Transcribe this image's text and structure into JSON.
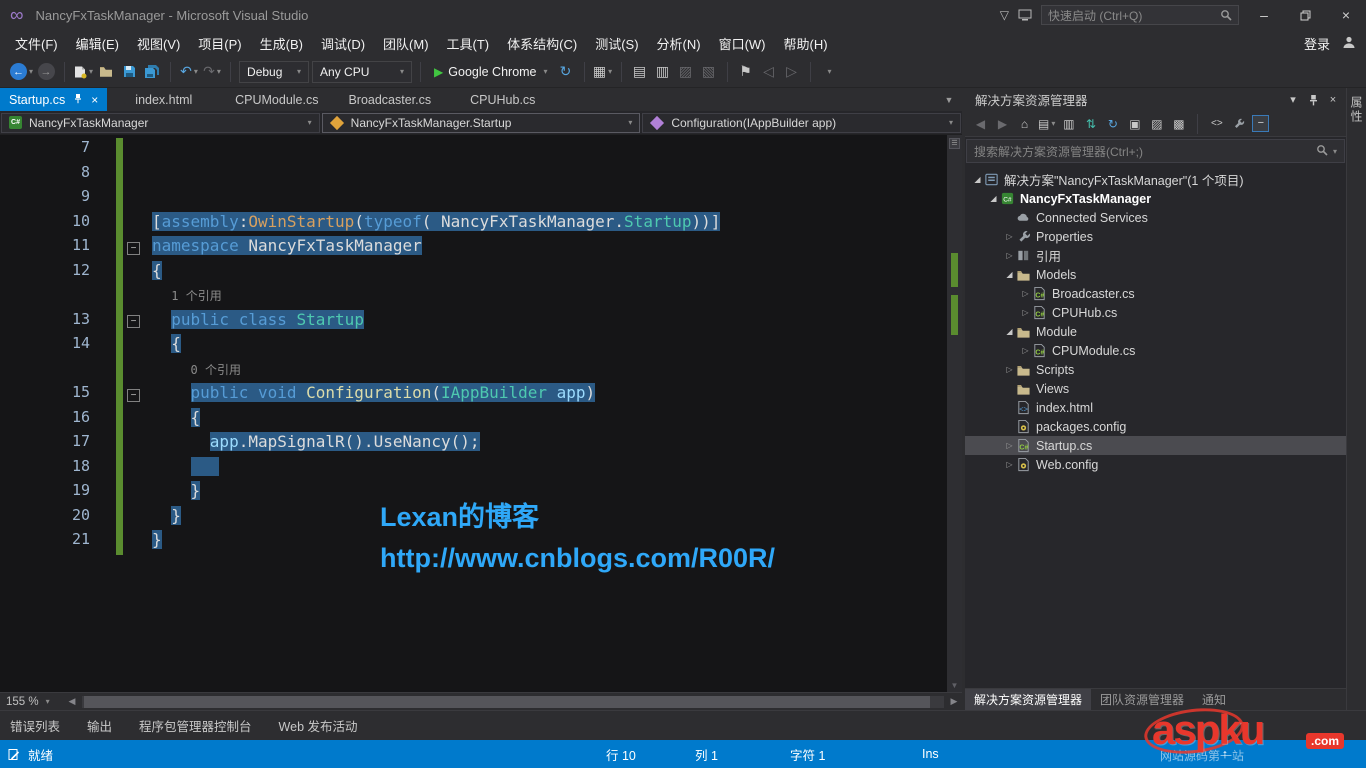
{
  "title_bar": {
    "title": "NancyFxTaskManager - Microsoft Visual Studio",
    "quick_launch_placeholder": "快速启动 (Ctrl+Q)"
  },
  "menu_bar": {
    "items": [
      "文件(F)",
      "编辑(E)",
      "视图(V)",
      "项目(P)",
      "生成(B)",
      "调试(D)",
      "团队(M)",
      "工具(T)",
      "体系结构(C)",
      "测试(S)",
      "分析(N)",
      "窗口(W)",
      "帮助(H)"
    ],
    "sign_in": "登录"
  },
  "toolbar": {
    "debug_config": "Debug",
    "platform": "Any CPU",
    "start_target": "Google Chrome"
  },
  "tab_bar": {
    "tabs": [
      {
        "label": "Startup.cs",
        "active": true,
        "pinned": true
      },
      {
        "label": "index.html",
        "active": false
      },
      {
        "label": "CPUModule.cs",
        "active": false
      },
      {
        "label": "Broadcaster.cs",
        "active": false
      },
      {
        "label": "CPUHub.cs",
        "active": false
      }
    ]
  },
  "nav_bar": {
    "project": "NancyFxTaskManager",
    "type": "NancyFxTaskManager.Startup",
    "member": "Configuration(IAppBuilder app)"
  },
  "editor": {
    "zoom": "155 %",
    "watermark_line1": "Lexan的博客",
    "watermark_line2": "http://www.cnblogs.com/R00R/",
    "code_rows": [
      {
        "n": "7",
        "chg": true,
        "pre": "",
        "seg": []
      },
      {
        "n": "8",
        "chg": true,
        "pre": "",
        "seg": []
      },
      {
        "n": "9",
        "chg": true,
        "pre": "",
        "seg": []
      },
      {
        "n": "10",
        "chg": true,
        "sel": true,
        "pre": "",
        "seg": [
          [
            "[",
            "pl"
          ],
          [
            "assembly",
            "kw"
          ],
          [
            ":",
            "pl"
          ],
          [
            "OwinStartup",
            "at"
          ],
          [
            "(",
            "pl"
          ],
          [
            "typeof",
            "kw"
          ],
          [
            "( ",
            "pl"
          ],
          [
            "NancyFxTaskManager",
            "pl"
          ],
          [
            ".",
            "pl"
          ],
          [
            "Startup",
            "ty"
          ],
          [
            "))]",
            "pl"
          ]
        ]
      },
      {
        "n": "11",
        "chg": true,
        "sel": true,
        "fold": true,
        "pre": "",
        "seg": [
          [
            "namespace",
            "kw"
          ],
          [
            " NancyFxTaskManager",
            "pl"
          ]
        ]
      },
      {
        "n": "12",
        "chg": true,
        "sel": true,
        "pre": "",
        "seg": [
          [
            "{",
            "pl"
          ]
        ]
      },
      {
        "n": "",
        "lens": true,
        "chg": true,
        "pre": "  ",
        "seg": [
          [
            "1 个引用",
            "lens"
          ]
        ]
      },
      {
        "n": "13",
        "chg": true,
        "sel": true,
        "fold": true,
        "pre": "  ",
        "seg": [
          [
            "public",
            "kw"
          ],
          [
            " ",
            "pl"
          ],
          [
            "class",
            "kw"
          ],
          [
            " ",
            "pl"
          ],
          [
            "Startup",
            "ty"
          ]
        ]
      },
      {
        "n": "14",
        "chg": true,
        "sel": true,
        "pre": "  ",
        "seg": [
          [
            "{",
            "pl"
          ]
        ]
      },
      {
        "n": "",
        "lens": true,
        "chg": true,
        "pre": "    ",
        "seg": [
          [
            "0 个引用",
            "lens"
          ]
        ]
      },
      {
        "n": "15",
        "chg": true,
        "sel": true,
        "fold": true,
        "pre": "    ",
        "seg": [
          [
            "public",
            "kw"
          ],
          [
            " ",
            "pl"
          ],
          [
            "void",
            "kw"
          ],
          [
            " ",
            "pl"
          ],
          [
            "Configuration",
            "me"
          ],
          [
            "(",
            "pl"
          ],
          [
            "IAppBuilder",
            "ty"
          ],
          [
            " ",
            "pl"
          ],
          [
            "app",
            "pa"
          ],
          [
            ")",
            "pl"
          ]
        ]
      },
      {
        "n": "16",
        "chg": true,
        "sel": true,
        "pre": "    ",
        "seg": [
          [
            "{",
            "pl"
          ]
        ]
      },
      {
        "n": "17",
        "chg": true,
        "sel": true,
        "pre": "      ",
        "seg": [
          [
            "app",
            "pa"
          ],
          [
            ".MapSignalR().UseNancy();",
            "pl"
          ]
        ]
      },
      {
        "n": "18",
        "chg": true,
        "sel": true,
        "pre": "    ",
        "seg": [
          [
            "   ",
            "pl"
          ]
        ]
      },
      {
        "n": "19",
        "chg": true,
        "sel": true,
        "pre": "    ",
        "seg": [
          [
            "}",
            "pl"
          ]
        ]
      },
      {
        "n": "20",
        "chg": true,
        "sel": true,
        "pre": "  ",
        "seg": [
          [
            "}",
            "pl"
          ]
        ]
      },
      {
        "n": "21",
        "chg": true,
        "sel": true,
        "pre": "",
        "seg": [
          [
            "}",
            "pl"
          ]
        ]
      }
    ]
  },
  "solution_explorer": {
    "title": "解决方案资源管理器",
    "search_placeholder": "搜索解决方案资源管理器(Ctrl+;)",
    "tree": [
      {
        "indent": 0,
        "arrow": "open",
        "icon": "solution",
        "label": "解决方案\"NancyFxTaskManager\"(1 个项目)"
      },
      {
        "indent": 1,
        "arrow": "open",
        "icon": "project",
        "label": "NancyFxTaskManager",
        "bold": true
      },
      {
        "indent": 2,
        "arrow": "none",
        "icon": "cloud",
        "label": "Connected Services"
      },
      {
        "indent": 2,
        "arrow": "closed",
        "icon": "wrench",
        "label": "Properties"
      },
      {
        "indent": 2,
        "arrow": "closed",
        "icon": "refs",
        "label": "引用"
      },
      {
        "indent": 2,
        "arrow": "open",
        "icon": "folder",
        "label": "Models"
      },
      {
        "indent": 3,
        "arrow": "closed",
        "icon": "cs",
        "label": "Broadcaster.cs"
      },
      {
        "indent": 3,
        "arrow": "closed",
        "icon": "cs",
        "label": "CPUHub.cs"
      },
      {
        "indent": 2,
        "arrow": "open",
        "icon": "folder",
        "label": "Module"
      },
      {
        "indent": 3,
        "arrow": "closed",
        "icon": "cs",
        "label": "CPUModule.cs"
      },
      {
        "indent": 2,
        "arrow": "closed",
        "icon": "folder",
        "label": "Scripts"
      },
      {
        "indent": 2,
        "arrow": "none",
        "icon": "folder",
        "label": "Views"
      },
      {
        "indent": 2,
        "arrow": "none",
        "icon": "html",
        "label": "index.html"
      },
      {
        "indent": 2,
        "arrow": "none",
        "icon": "config",
        "label": "packages.config"
      },
      {
        "indent": 2,
        "arrow": "closed",
        "icon": "cs",
        "label": "Startup.cs",
        "selected": true
      },
      {
        "indent": 2,
        "arrow": "closed",
        "icon": "config",
        "label": "Web.config"
      }
    ],
    "bottom_tabs": [
      {
        "label": "解决方案资源管理器",
        "active": true
      },
      {
        "label": "团队资源管理器",
        "active": false
      },
      {
        "label": "通知",
        "active": false
      }
    ]
  },
  "side_strip": {
    "vertical_tab": "属性"
  },
  "bottom_panel_tabs": [
    "错误列表",
    "输出",
    "程序包管理器控制台",
    "Web 发布活动"
  ],
  "status_bar": {
    "ready": "就绪",
    "line": "行 10",
    "column": "列 1",
    "char": "字符 1",
    "mode": "Ins"
  },
  "watermark_logo": {
    "brand": "aspku",
    "tld": ".com",
    "tagline": "网站源码第一站"
  }
}
